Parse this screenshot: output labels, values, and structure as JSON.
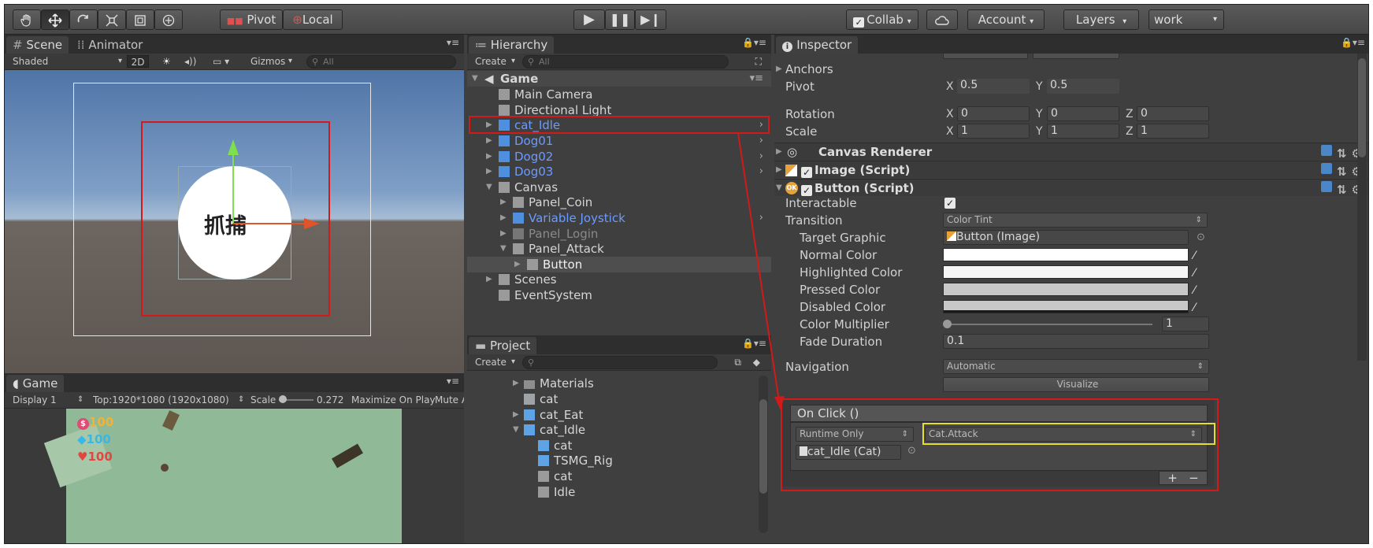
{
  "toolbar": {
    "tools": [
      "hand",
      "move",
      "rotate",
      "scale",
      "rect",
      "transform"
    ],
    "pivot_label": "Pivot",
    "local_label": "Local",
    "collab_label": "Collab",
    "account_label": "Account",
    "layers_label": "Layers",
    "layout_label": "work"
  },
  "scene": {
    "tab_scene": "Scene",
    "tab_animator": "Animator",
    "shading": "Shaded",
    "mode_2d": "2D",
    "gizmos": "Gizmos",
    "search_placeholder": "All",
    "button_text": "抓捕"
  },
  "game": {
    "tab_label": "Game",
    "display": "Display 1",
    "resolution": "Top:1920*1080 (1920x1080)",
    "scale_label": "Scale",
    "scale_value": "0.272",
    "maximize": "Maximize On Play",
    "mute": "Mute A",
    "coin": "100",
    "gem": "100",
    "heart": "100"
  },
  "hierarchy": {
    "tab_label": "Hierarchy",
    "create_label": "Create",
    "search_placeholder": "All",
    "scene_name": "Game",
    "items": [
      {
        "label": "Main Camera",
        "style": "normal"
      },
      {
        "label": "Directional Light",
        "style": "normal"
      },
      {
        "label": "cat_Idle",
        "style": "prefab"
      },
      {
        "label": "Dog01",
        "style": "prefab"
      },
      {
        "label": "Dog02",
        "style": "prefab"
      },
      {
        "label": "Dog03",
        "style": "prefab"
      },
      {
        "label": "Canvas",
        "style": "normal"
      },
      {
        "label": "Panel_Coin",
        "style": "normal"
      },
      {
        "label": "Variable Joystick",
        "style": "prefab"
      },
      {
        "label": "Panel_Login",
        "style": "dim"
      },
      {
        "label": "Panel_Attack",
        "style": "normal"
      },
      {
        "label": "Button",
        "style": "selected"
      },
      {
        "label": "Scenes",
        "style": "normal"
      },
      {
        "label": "EventSystem",
        "style": "normal"
      }
    ]
  },
  "project": {
    "tab_label": "Project",
    "create_label": "Create",
    "items": [
      {
        "label": "Materials"
      },
      {
        "label": "cat"
      },
      {
        "label": "cat_Eat"
      },
      {
        "label": "cat_Idle"
      },
      {
        "label": "cat"
      },
      {
        "label": "TSMG_Rig"
      },
      {
        "label": "cat"
      },
      {
        "label": "Idle"
      }
    ]
  },
  "inspector": {
    "tab_label": "Inspector",
    "anchors": "Anchors",
    "pivot_label": "Pivot",
    "pivot_x": "0.5",
    "pivot_y": "0.5",
    "rotation_label": "Rotation",
    "rot_x": "0",
    "rot_y": "0",
    "rot_z": "0",
    "scale_label": "Scale",
    "scale_x": "1",
    "scale_y": "1",
    "scale_z": "1",
    "canvas_renderer": "Canvas Renderer",
    "image_script": "Image (Script)",
    "button_script": "Button (Script)",
    "interactable": "Interactable",
    "transition": "Transition",
    "transition_value": "Color Tint",
    "target_graphic": "Target Graphic",
    "target_graphic_value": "Button (Image)",
    "normal_color": "Normal Color",
    "highlighted_color": "Highlighted Color",
    "pressed_color": "Pressed Color",
    "disabled_color": "Disabled Color",
    "color_multiplier": "Color Multiplier",
    "color_multiplier_value": "1",
    "fade_duration": "Fade Duration",
    "fade_duration_value": "0.1",
    "navigation": "Navigation",
    "navigation_value": "Automatic",
    "visualize": "Visualize",
    "on_click": "On Click ()",
    "runtime": "Runtime Only",
    "function": "Cat.Attack",
    "object": "cat_Idle (Cat)",
    "plus": "+",
    "minus": "−"
  }
}
